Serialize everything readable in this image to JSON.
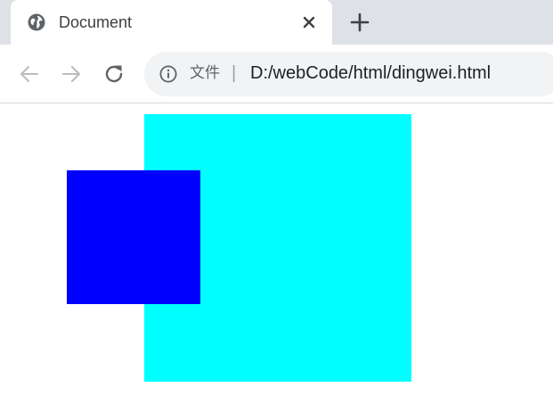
{
  "browser": {
    "tab": {
      "title": "Document",
      "favicon_icon": "globe-icon",
      "close_icon": "close-icon"
    },
    "new_tab_icon": "plus-icon",
    "nav": {
      "back_icon": "arrow-left-icon",
      "forward_icon": "arrow-right-icon",
      "reload_icon": "reload-icon"
    },
    "omnibox": {
      "info_icon": "info-icon",
      "scheme_label": "文件",
      "separator": "|",
      "url": "D:/webCode/html/dingwei.html"
    }
  },
  "page": {
    "big_box_color": "#00ffff",
    "small_box_color": "#0000ff"
  }
}
